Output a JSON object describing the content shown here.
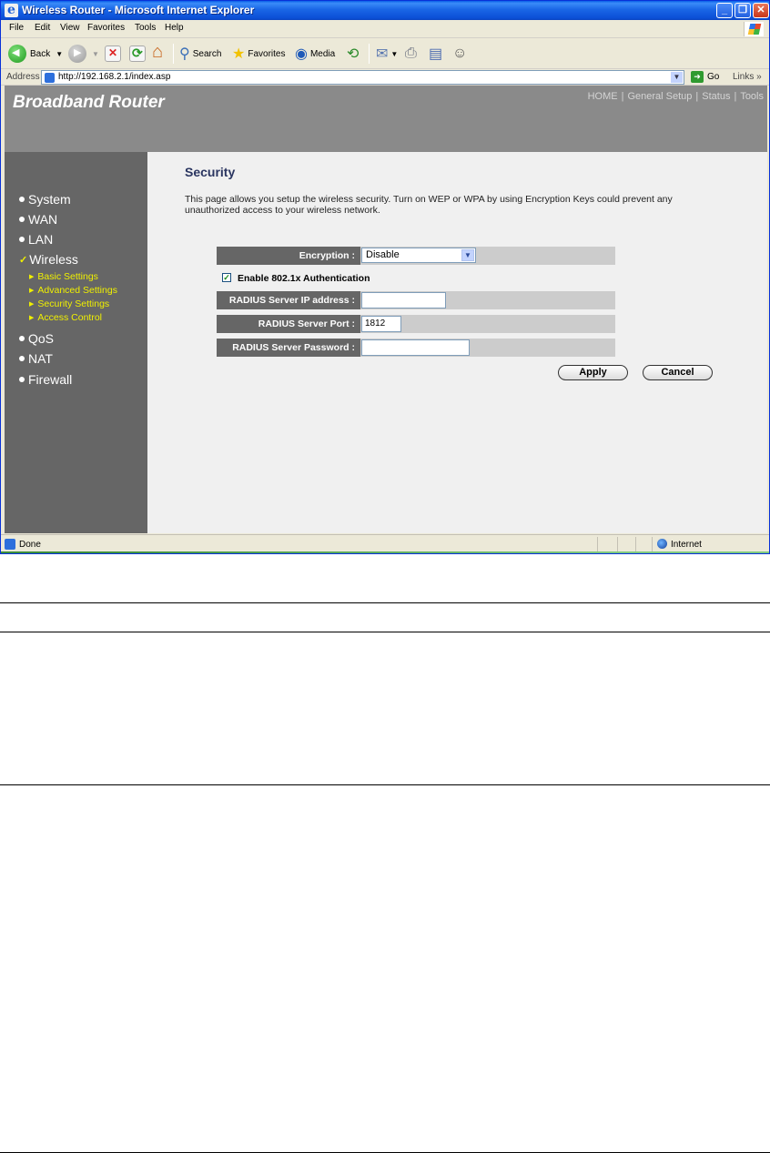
{
  "window": {
    "title": "Wireless Router - Microsoft Internet Explorer",
    "controls": {
      "minimize": "_",
      "maximize": "❐",
      "close": "✕"
    }
  },
  "menu": {
    "items": [
      "File",
      "Edit",
      "View",
      "Favorites",
      "Tools",
      "Help"
    ]
  },
  "toolbar": {
    "back": "Back",
    "search": "Search",
    "favorites": "Favorites",
    "media": "Media"
  },
  "address": {
    "label": "Address",
    "url": "http://192.168.2.1/index.asp",
    "go": "Go",
    "links": "Links"
  },
  "router": {
    "brand": "Broadband Router",
    "topnav": [
      "HOME",
      "General Setup",
      "Status",
      "Tools"
    ],
    "topnav_sep": "|",
    "sidebar": {
      "items": [
        "System",
        "WAN",
        "LAN",
        "Wireless",
        "QoS",
        "NAT",
        "Firewall"
      ],
      "subitems": [
        "Basic Settings",
        "Advanced Settings",
        "Security Settings",
        "Access Control"
      ]
    },
    "section": {
      "title": "Security",
      "description": "This page allows you setup the wireless security. Turn on WEP or WPA by using Encryption Keys could prevent any unauthorized access to your wireless network."
    },
    "form": {
      "encryption_label": "Encryption :",
      "encryption_value": "Disable",
      "auth_label": "Enable 802.1x Authentication",
      "auth_checked": true,
      "radius_ip_label": "RADIUS Server IP address :",
      "radius_ip_value": "",
      "radius_port_label": "RADIUS Server Port :",
      "radius_port_value": "1812",
      "radius_password_label": "RADIUS Server Password :",
      "radius_password_value": "",
      "apply": "Apply",
      "cancel": "Cancel"
    }
  },
  "status": {
    "text": "Done",
    "zone": "Internet"
  },
  "colors": {
    "title_bar": "#0b4fd6",
    "header_bg": "#8a8a8a",
    "sidebar_bg": "#666666",
    "sub_menu": "#f0f000",
    "section_title": "#2a3560"
  }
}
